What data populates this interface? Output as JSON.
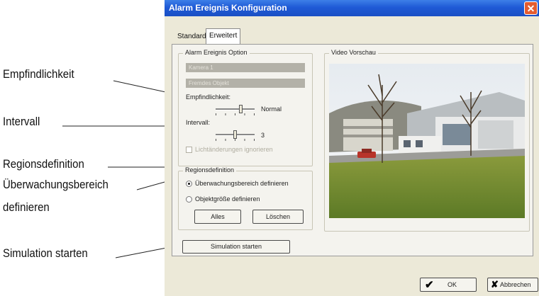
{
  "callouts": [
    "Empfindlichkeit",
    "Intervall",
    "Regionsdefinition",
    "Überwachungsbereich",
    "definieren",
    "Simulation starten"
  ],
  "dialog": {
    "title": "Alarm Ereignis Konfiguration",
    "close_glyph": "✕",
    "tabs": [
      "Standard",
      "Erweitert"
    ],
    "active_tab": "Erweitert"
  },
  "option_group": {
    "legend": "Alarm Ereignis Option",
    "field1": "Kamera 1",
    "field2": "Fremdes Objekt",
    "sensitivity_label": "Empfindlichkeit:",
    "sensitivity_value": "Normal",
    "sensitivity_level": 0.65,
    "interval_label": "Intervall:",
    "interval_value": "3",
    "interval_level": 0.5,
    "ignore_light_label": "Lichtänderungen ignorieren",
    "ignore_light_checked": false
  },
  "preview_group": {
    "legend": "Video Vorschau"
  },
  "region_group": {
    "legend": "Regionsdefinition",
    "option1": "Überwachungsbereich definieren",
    "option2": "Objektgröße definieren",
    "selected": "option1",
    "all_button": "Alles",
    "delete_button": "Löschen"
  },
  "simulate_button": "Simulation starten",
  "footer": {
    "ok_label": "OK",
    "cancel_label": "Abbrechen"
  },
  "colors": {
    "titlebar": "#1f5ad6",
    "dialog_bg": "#ece9d8",
    "close": "#e45c2f",
    "ok_check": "#000000",
    "cancel_x": "#000000"
  }
}
